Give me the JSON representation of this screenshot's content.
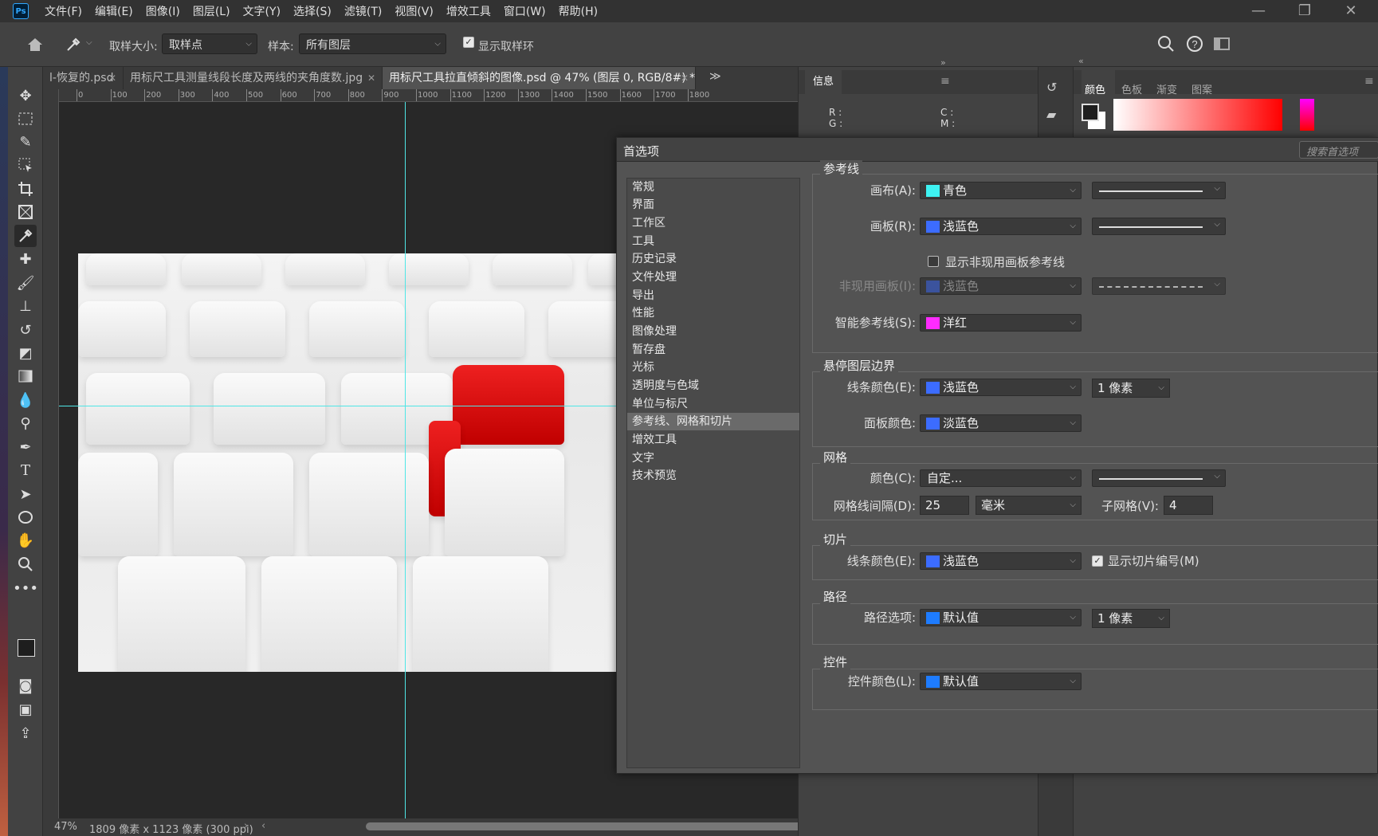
{
  "app": {
    "logo": "Ps",
    "minimize": "—",
    "restore": "❐",
    "close": "✕"
  },
  "menu": [
    "文件(F)",
    "编辑(E)",
    "图像(I)",
    "图层(L)",
    "文字(Y)",
    "选择(S)",
    "滤镜(T)",
    "视图(V)",
    "增效工具",
    "窗口(W)",
    "帮助(H)"
  ],
  "options": {
    "sample_size_label": "取样大小:",
    "sample_size_value": "取样点",
    "sample_label": "样本:",
    "sample_value": "所有图层",
    "show_ring_label": "显示取样环",
    "show_ring_checked": true
  },
  "tabs": [
    {
      "label": "l-恢复的.psd",
      "active": false
    },
    {
      "label": "用标尺工具测量线段长度及两线的夹角度数.jpg",
      "active": false
    },
    {
      "label": "用标尺工具拉直倾斜的图像.psd @ 47% (图层 0, RGB/8#) *",
      "active": true
    }
  ],
  "ruler_marks": [
    "0",
    "100",
    "200",
    "300",
    "400",
    "500",
    "600",
    "700",
    "800",
    "900",
    "1000",
    "1100",
    "1200",
    "1300",
    "1400",
    "1500",
    "1600",
    "1700",
    "1800"
  ],
  "status": {
    "zoom": "47%",
    "doc_info": "1809 像素 x 1123 像素 (300 ppi)"
  },
  "info_panel": {
    "tab": "信息",
    "r_label": "R :",
    "g_label": "G :",
    "c_label": "C :",
    "m_label": "M :"
  },
  "color_panel": {
    "tabs": [
      "颜色",
      "色板",
      "渐变",
      "图案"
    ],
    "active_tab": "颜色"
  },
  "prefs": {
    "title": "首选项",
    "search_placeholder": "搜索首选项",
    "nav": [
      "常规",
      "界面",
      "工作区",
      "工具",
      "历史记录",
      "文件处理",
      "导出",
      "性能",
      "图像处理",
      "暂存盘",
      "光标",
      "透明度与色域",
      "单位与标尺",
      "参考线、网格和切片",
      "增效工具",
      "文字",
      "技术预览"
    ],
    "nav_selected": "参考线、网格和切片",
    "guides": {
      "title": "参考线",
      "canvas_label": "画布(A):",
      "canvas_color": "青色",
      "canvas_swatch": "#3ef2f2",
      "artboard_label": "画板(R):",
      "artboard_color": "浅蓝色",
      "artboard_swatch": "#3c6cff",
      "show_inactive_label": "显示非现用画板参考线",
      "show_inactive_checked": false,
      "inactive_label": "非现用画板(I):",
      "inactive_color": "浅蓝色",
      "inactive_swatch": "#3c6cff",
      "smart_label": "智能参考线(S):",
      "smart_color": "洋红",
      "smart_swatch": "#ff2bff"
    },
    "hover": {
      "title": "悬停图层边界",
      "line_label": "线条颜色(E):",
      "line_color": "浅蓝色",
      "line_swatch": "#3c6cff",
      "line_width": "1 像素",
      "panel_label": "面板颜色:",
      "panel_color": "淡蓝色",
      "panel_swatch": "#3c6cff"
    },
    "grid": {
      "title": "网格",
      "color_label": "颜色(C):",
      "color_value": "自定...",
      "spacing_label": "网格线间隔(D):",
      "spacing_value": "25",
      "spacing_unit": "毫米",
      "sub_label": "子网格(V):",
      "sub_value": "4"
    },
    "slices": {
      "title": "切片",
      "line_label": "线条颜色(E):",
      "line_color": "浅蓝色",
      "line_swatch": "#3c6cff",
      "show_numbers_label": "显示切片编号(M)",
      "show_numbers_checked": true
    },
    "paths": {
      "title": "路径",
      "options_label": "路径选项:",
      "options_color": "默认值",
      "options_swatch": "#1e7cff",
      "width": "1 像素"
    },
    "controls": {
      "title": "控件",
      "color_label": "控件颜色(L):",
      "color_value": "默认值",
      "color_swatch": "#1e7cff"
    }
  },
  "icons": [
    "move-icon",
    "marquee-icon",
    "quick-select-icon",
    "object-select-icon",
    "crop-icon",
    "frame-icon",
    "eyedropper-icon",
    "healing-icon",
    "brush-icon",
    "stamp-icon",
    "history-brush-icon",
    "eraser-icon",
    "gradient-icon",
    "blur-icon",
    "dodge-icon",
    "pen-icon",
    "type-icon",
    "path-select-icon",
    "ellipse-icon",
    "hand-icon",
    "zoom-icon",
    "more-icon"
  ]
}
